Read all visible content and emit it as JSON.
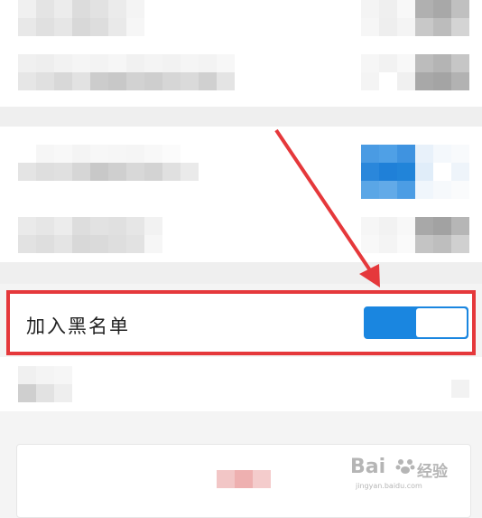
{
  "blacklist_row": {
    "label": "加入黑名单",
    "toggle_on": true
  },
  "watermark": {
    "brand": "Bai",
    "suffix": "经验",
    "url": "jingyan.baidu.com"
  },
  "colors": {
    "accent": "#1a86e0",
    "highlight": "#e5383b",
    "background": "#f4f4f4"
  },
  "icons": {
    "pointer": "red-arrow-icon",
    "watermark_logo": "baidu-paw-icon"
  }
}
